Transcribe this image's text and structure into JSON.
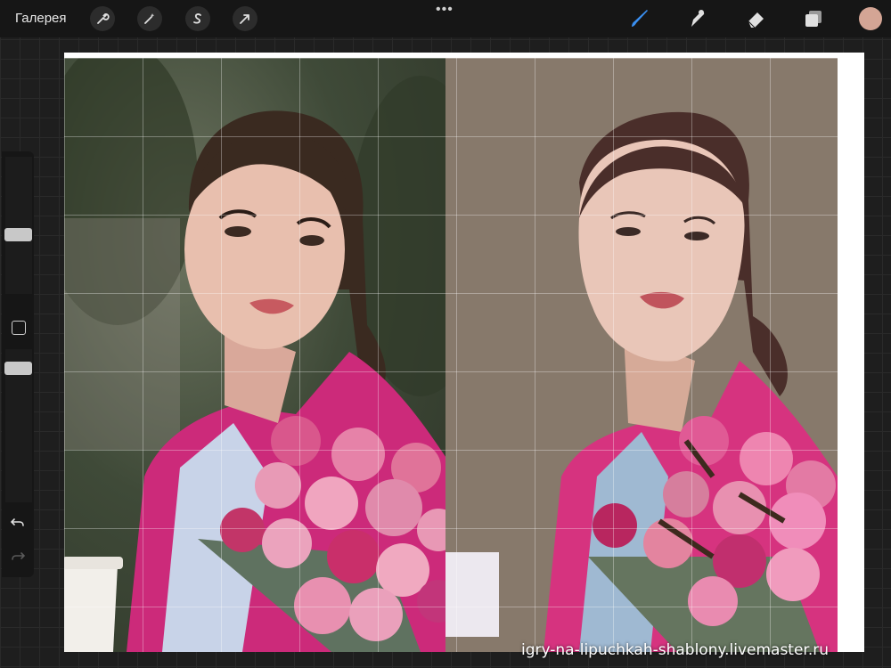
{
  "topbar": {
    "gallery_label": "Галерея",
    "tools_left": [
      "wrench-icon",
      "magic-wand-icon",
      "selection-s-icon",
      "arrow-transform-icon"
    ],
    "more_label": "•••",
    "tools_right": [
      "brush-icon",
      "smudge-icon",
      "eraser-icon",
      "layers-icon"
    ]
  },
  "colors": {
    "active_tool": "#3a8ff0",
    "current_color": "#d4a595",
    "coat_pink": "#d6337f",
    "background_taupe": "#87796b"
  },
  "sidebar": {
    "brush_size_label": "brush size",
    "opacity_label": "opacity"
  },
  "watermark": {
    "text": "igry-na-lipuchkah-shablony.livemaster.ru"
  }
}
